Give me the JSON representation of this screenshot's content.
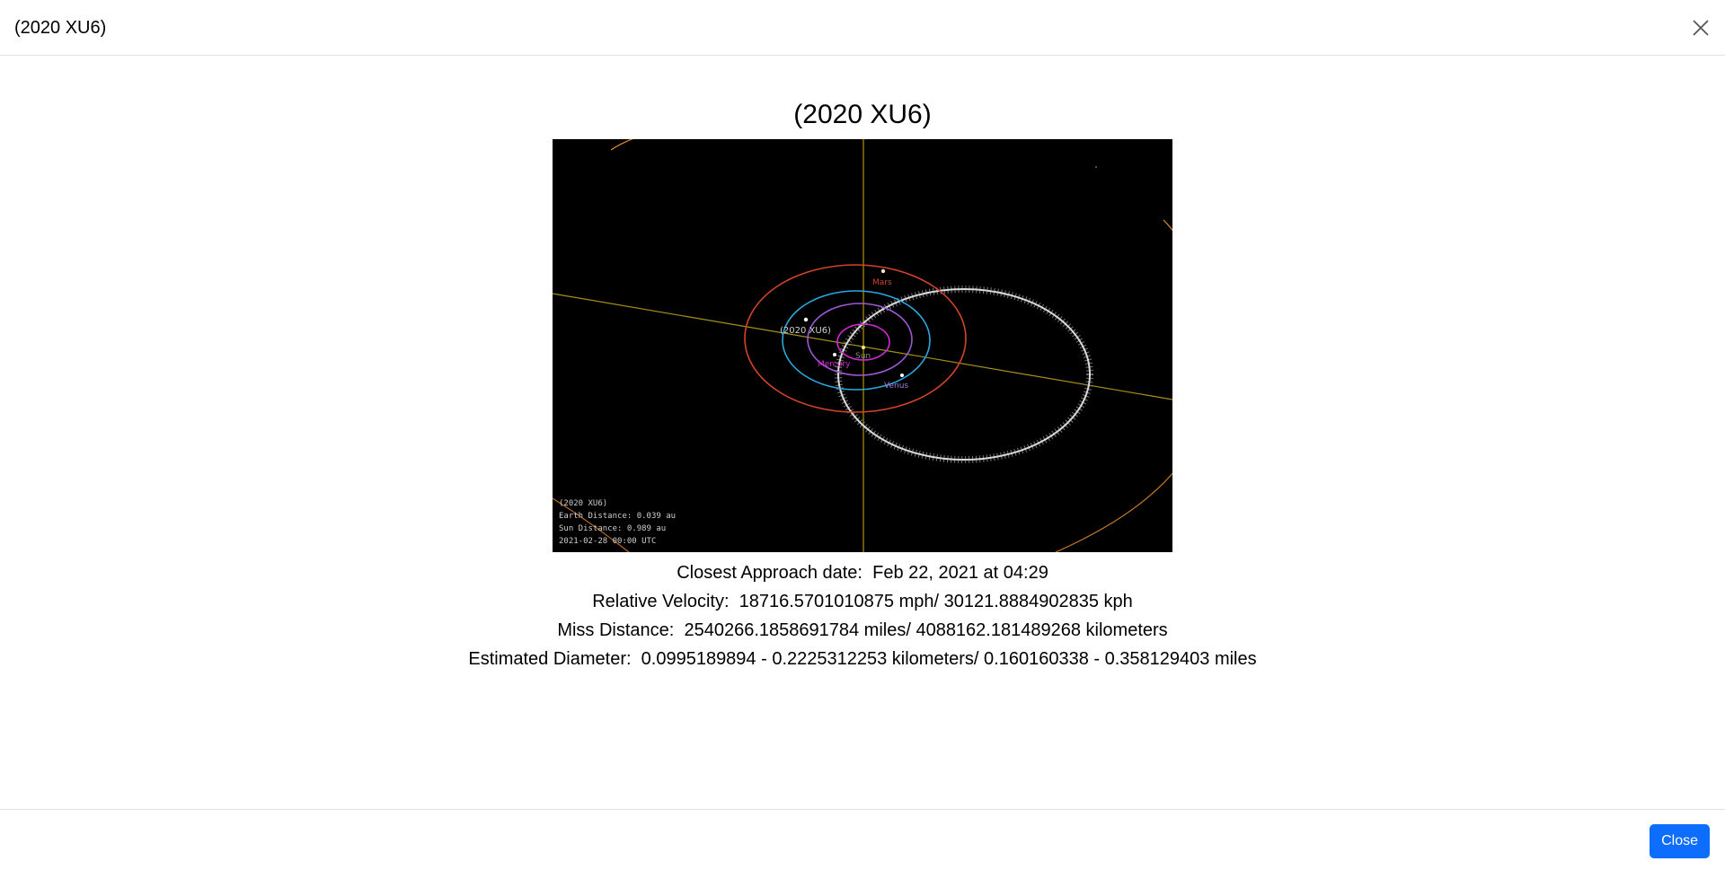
{
  "header": {
    "title": "(2020 XU6)",
    "close_icon": "close-icon"
  },
  "body": {
    "title": "(2020 XU6)",
    "orbit_image": {
      "object_label": "(2020 XU6)",
      "planet_labels": {
        "mars": "Mars",
        "venus": "Venus",
        "mercury": "Mercury",
        "sun": "Sun"
      },
      "info_lines": [
        "(2020 XU6)",
        "Earth Distance: 0.039 au",
        "Sun Distance: 0.989 au",
        "2021-02-28 00:00 UTC"
      ],
      "colors": {
        "mars": "#d2432a",
        "earth": "#2aa8e0",
        "venus": "#9b59d0",
        "mercury": "#d42bd4",
        "asteroid": "#d9d9d9",
        "axis": "#c8a400"
      }
    },
    "details": [
      "Closest Approach date:  Feb 22, 2021 at 04:29",
      "Relative Velocity:  18716.5701010875 mph/ 30121.8884902835 kph",
      "Miss Distance:  2540266.1858691784 miles/ 4088162.181489268 kilometers",
      "Estimated Diameter:  0.0995189894 - 0.2225312253 kilometers/ 0.160160338 - 0.358129403 miles"
    ]
  },
  "footer": {
    "close_label": "Close"
  },
  "colors": {
    "primary": "#0d6efd",
    "border": "#dee2e6"
  }
}
